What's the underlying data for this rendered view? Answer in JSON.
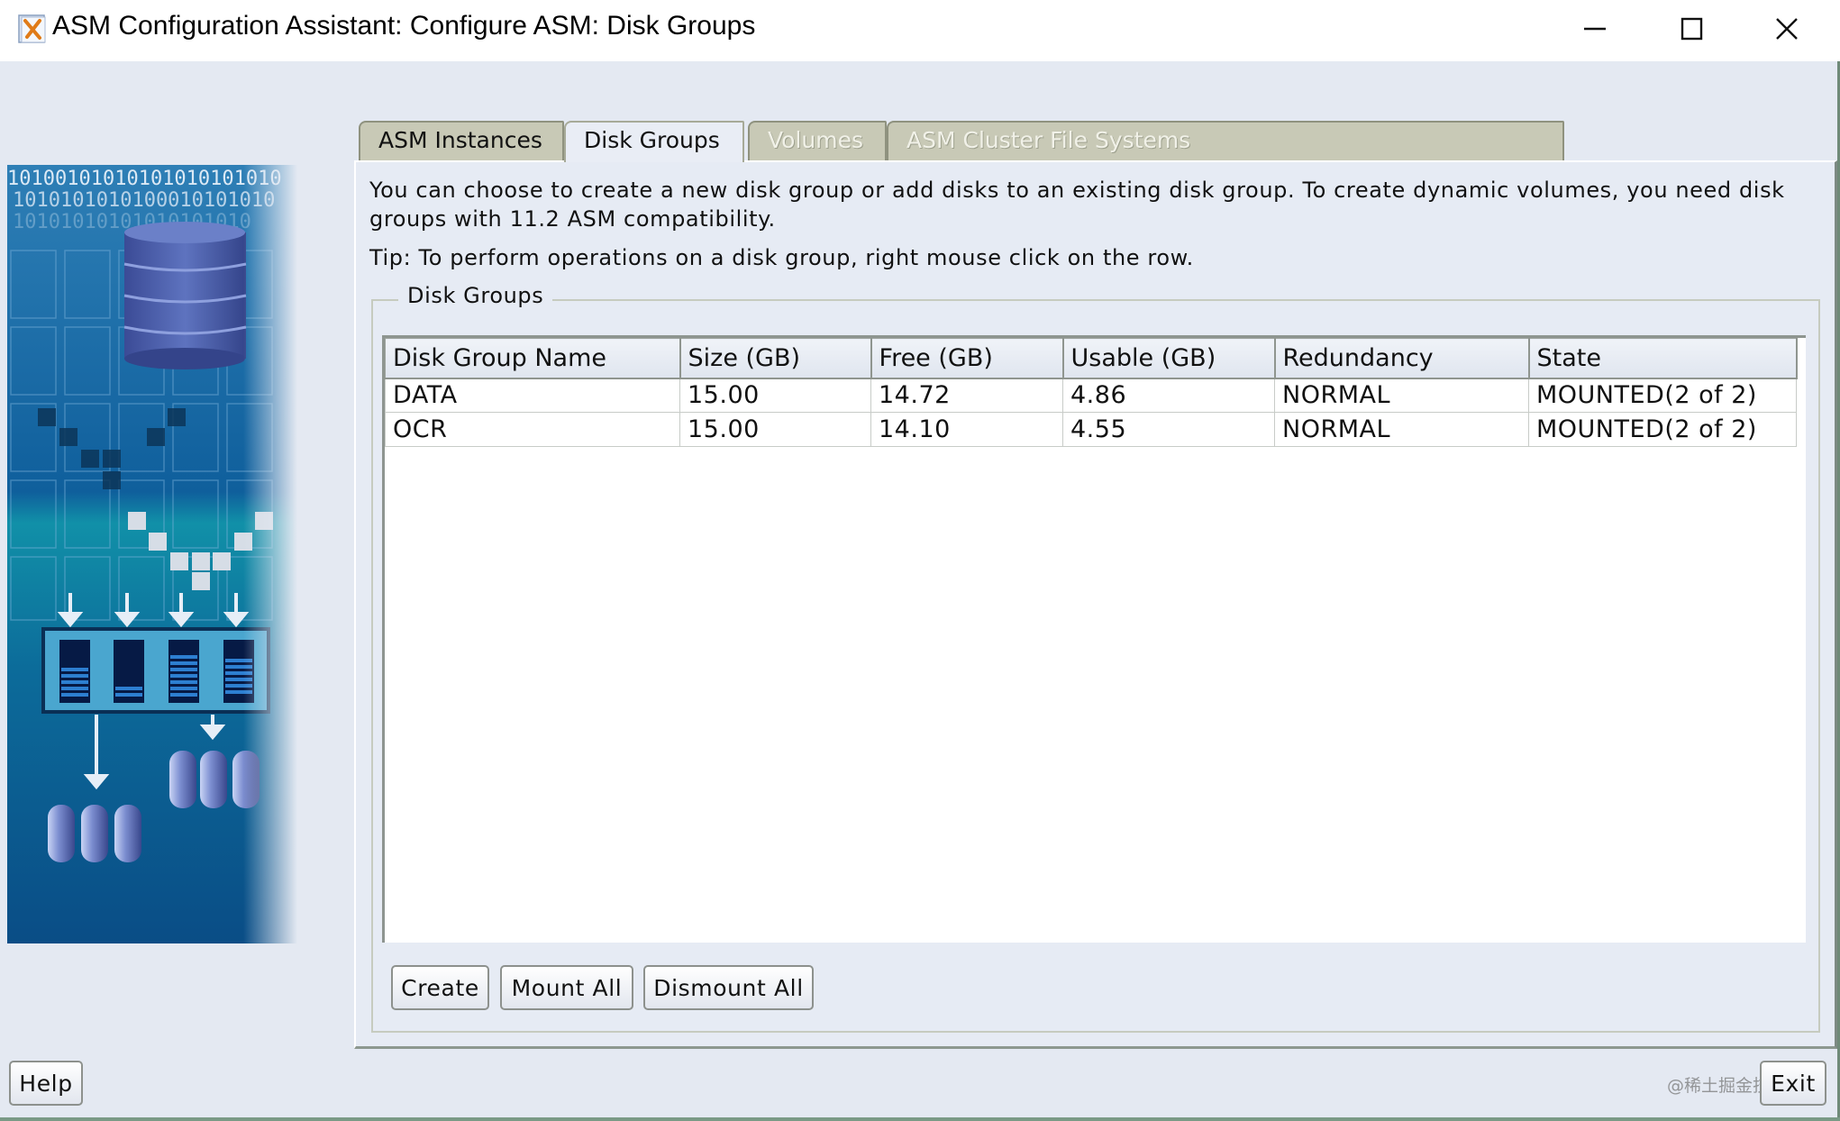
{
  "window": {
    "title": "ASM Configuration Assistant: Configure ASM: Disk Groups",
    "app_icon": "oracle-x-icon",
    "controls": {
      "minimize_icon": "minimize-icon",
      "maximize_icon": "maximize-icon",
      "close_icon": "close-icon"
    }
  },
  "tabs": [
    {
      "label": "ASM Instances",
      "state": "enabled"
    },
    {
      "label": "Disk Groups",
      "state": "active"
    },
    {
      "label": "Volumes",
      "state": "disabled"
    },
    {
      "label": "ASM Cluster File Systems",
      "state": "disabled"
    }
  ],
  "content": {
    "description": "You can choose to create a new disk group or add disks to an existing disk group. To create dynamic volumes, you need disk groups with 11.2 ASM compatibility.",
    "tip": "Tip: To perform operations on a disk group, right mouse click on the row."
  },
  "disk_groups": {
    "legend": "Disk Groups",
    "columns": [
      "Disk Group Name",
      "Size (GB)",
      "Free (GB)",
      "Usable (GB)",
      "Redundancy",
      "State"
    ],
    "rows": [
      [
        "DATA",
        "15.00",
        "14.72",
        "4.86",
        "NORMAL",
        "MOUNTED(2 of 2)"
      ],
      [
        "OCR",
        "15.00",
        "14.10",
        "4.55",
        "NORMAL",
        "MOUNTED(2 of 2)"
      ]
    ],
    "buttons": {
      "create": "Create",
      "mount_all": "Mount All",
      "dismount_all": "Dismount All"
    }
  },
  "footer": {
    "help": "Help",
    "exit": "Exit"
  },
  "side_image": {
    "binary_rows": [
      "10100101010101010101010",
      "1010101010100010101010",
      "10101010101010101010"
    ]
  },
  "watermark": "@稀土掘金技术社区",
  "colors": {
    "panel_bg": "#e6ebf4",
    "tab_inactive_bg": "#c8c9b6",
    "side_image_blue": "#0a5a96"
  }
}
